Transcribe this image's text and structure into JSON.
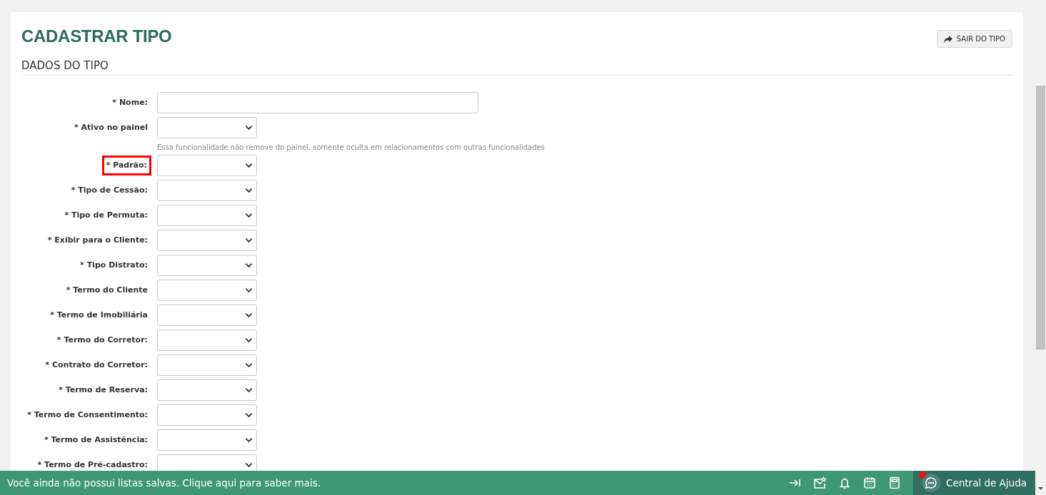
{
  "page": {
    "title": "CADASTRAR TIPO",
    "exit_button": "SAIR DO TIPO",
    "section": "DADOS DO TIPO"
  },
  "fields": [
    {
      "kind": "text",
      "label": "* Nome:",
      "highlighted": false
    },
    {
      "kind": "select",
      "label": "* Ativo no painel",
      "hint": "Essa funcionalidade não remove do painel, somente oculta em relacionamentos com outras funcionalidades",
      "highlighted": false
    },
    {
      "kind": "select",
      "label": "* Padrão:",
      "highlighted": true
    },
    {
      "kind": "select",
      "label": "* Tipo de Cessão:",
      "highlighted": false
    },
    {
      "kind": "select",
      "label": "* Tipo de Permuta:",
      "highlighted": false
    },
    {
      "kind": "select",
      "label": "* Exibir para o Cliente:",
      "highlighted": false
    },
    {
      "kind": "select",
      "label": "* Tipo Distrato:",
      "highlighted": false
    },
    {
      "kind": "select",
      "label": "* Termo do Cliente",
      "highlighted": false
    },
    {
      "kind": "select",
      "label": "* Termo de Imobiliária",
      "highlighted": false
    },
    {
      "kind": "select",
      "label": "* Termo do Corretor:",
      "highlighted": false
    },
    {
      "kind": "select",
      "label": "* Contrato do Corretor:",
      "highlighted": false
    },
    {
      "kind": "select",
      "label": "* Termo de Reserva:",
      "highlighted": false
    },
    {
      "kind": "select",
      "label": "* Termo de Consentimento:",
      "highlighted": false
    },
    {
      "kind": "select",
      "label": "* Termo de Assistência:",
      "highlighted": false
    },
    {
      "kind": "select",
      "label": "* Termo de Pré-cadastro:",
      "highlighted": false
    }
  ],
  "footer": {
    "message": "Você ainda não possui listas salvas. Clique aqui para saber mais.",
    "help": "Central de Ajuda",
    "help_notification": true
  }
}
